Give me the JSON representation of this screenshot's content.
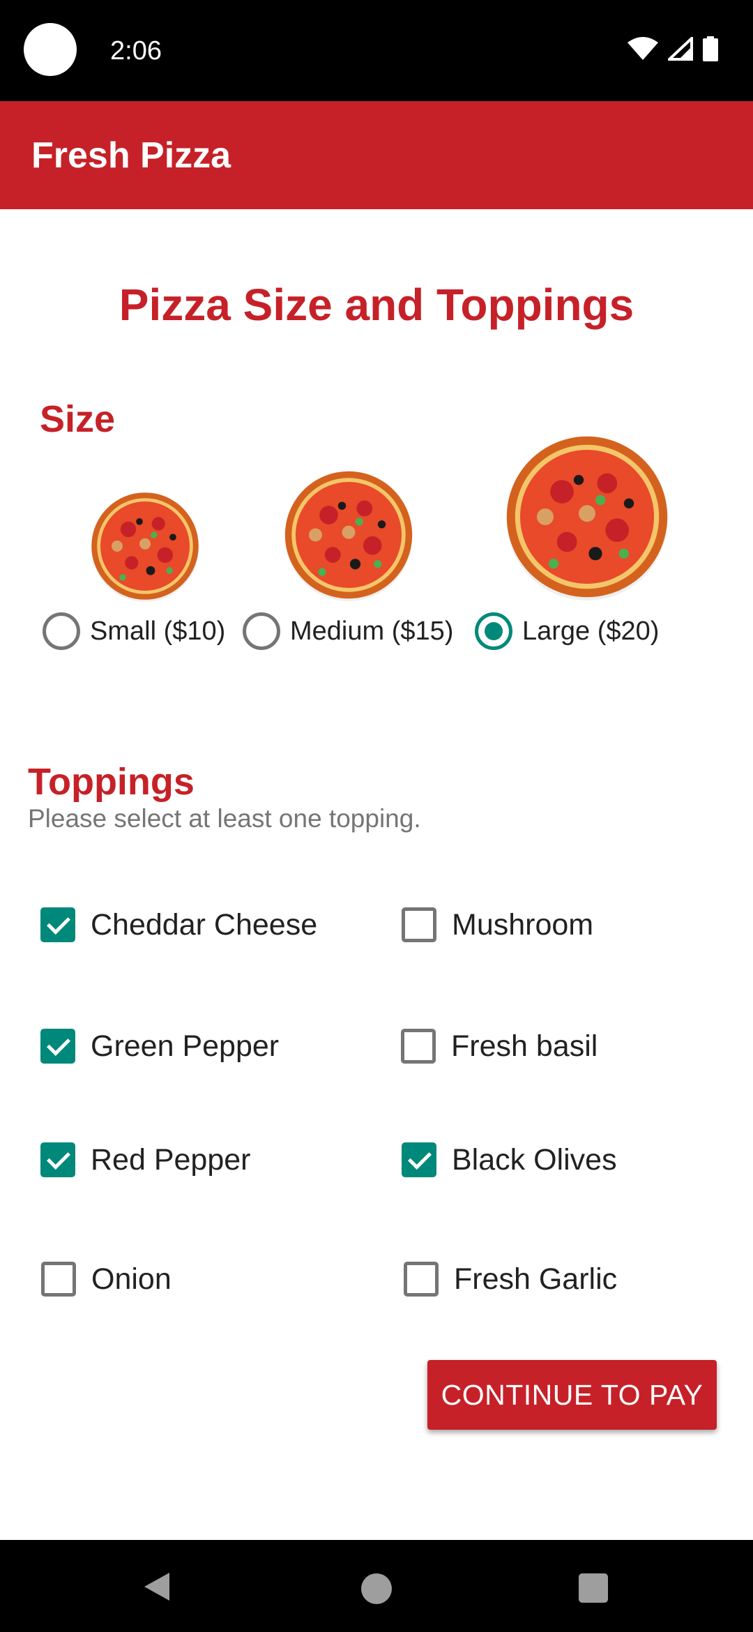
{
  "status_bar": {
    "time": "2:06",
    "icons": [
      "wifi-icon",
      "cell-signal-icon",
      "battery-icon"
    ]
  },
  "app_bar": {
    "title": "Fresh Pizza",
    "color": "#c62128"
  },
  "page": {
    "title": "Pizza Size and Toppings"
  },
  "size_section": {
    "title": "Size",
    "options": [
      {
        "label": "Small ($10)",
        "selected": false
      },
      {
        "label": "Medium ($15)",
        "selected": false
      },
      {
        "label": "Large ($20)",
        "selected": true
      }
    ]
  },
  "toppings_section": {
    "title": "Toppings",
    "hint": "Please select at least one topping.",
    "options": [
      {
        "label": "Cheddar Cheese",
        "checked": true
      },
      {
        "label": "Mushroom",
        "checked": false
      },
      {
        "label": "Green Pepper",
        "checked": true
      },
      {
        "label": "Fresh basil",
        "checked": false
      },
      {
        "label": "Red Pepper",
        "checked": true
      },
      {
        "label": "Black Olives",
        "checked": true
      },
      {
        "label": "Onion",
        "checked": false
      },
      {
        "label": "Fresh Garlic",
        "checked": false
      }
    ]
  },
  "actions": {
    "continue_label": "CONTINUE TO PAY"
  },
  "colors": {
    "accent": "#00897b",
    "brand": "#c62128"
  }
}
